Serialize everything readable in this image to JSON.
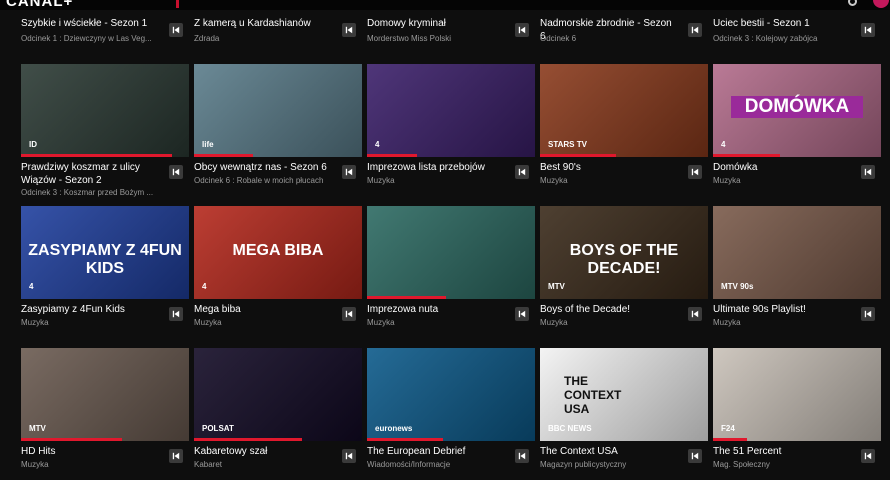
{
  "app": {
    "logo": "CANAL+"
  },
  "row0": [
    {
      "title": "Szybkie i wściekłe - Sezon 1",
      "sub": "Odcinek 1 : Dziewczyny w Las Veg..."
    },
    {
      "title": "Z kamerą u Kardashianów",
      "sub": "Zdrada"
    },
    {
      "title": "Domowy kryminał",
      "sub": "Morderstwo Miss Polski"
    },
    {
      "title": "Nadmorskie zbrodnie - Sezon 6",
      "sub": "Odcinek 6"
    },
    {
      "title": "Uciec bestii - Sezon 1",
      "sub": "Odcinek 3 : Kolejowy zabójca"
    }
  ],
  "row1": [
    {
      "title": "Prawdziwy koszmar z ulicy Wiązów - Sezon 2",
      "sub": "Odcinek 3 : Koszmar przed Bożym ...",
      "badge": "ID",
      "bg": "#2b3a34",
      "progress": 0.9
    },
    {
      "title": "Obcy wewnątrz nas - Sezon 6",
      "sub": "Odcinek 6 : Robale w moich płucach",
      "badge": "life",
      "bg": "#5a7c8a",
      "progress": 0.35
    },
    {
      "title": "Imprezowa lista przebojów",
      "sub": "Muzyka",
      "badge": "4",
      "bg": "#3b1f6a",
      "progress": 0.3
    },
    {
      "title": "Best 90's",
      "sub": "Muzyka",
      "badge": "STARS TV",
      "bg": "#8a3a1c",
      "progress": 0.45
    },
    {
      "title": "Domówka",
      "sub": "Muzyka",
      "badge": "4",
      "bg": "#b26b8a",
      "progress": 0.4,
      "overlay": "DOMÓWKA"
    }
  ],
  "row2": [
    {
      "title": "Zasypiamy z 4Fun Kids",
      "sub": "Muzyka",
      "badge": "4",
      "bg": "#1f3f9e",
      "progress": 0.0,
      "overlay": "ZASYPIAMY Z 4FUN KIDS"
    },
    {
      "title": "Mega biba",
      "sub": "Muzyka",
      "badge": "4",
      "bg": "#b5281c",
      "progress": 0.0,
      "overlay": "MEGA BIBA"
    },
    {
      "title": "Imprezowa nuta",
      "sub": "Muzyka",
      "badge": "",
      "bg": "#2c6a62",
      "progress": 0.47
    },
    {
      "title": "Boys of the Decade!",
      "sub": "Muzyka",
      "badge": "MTV",
      "bg": "#3a2a1a",
      "progress": 0.0,
      "overlay": "BOYS OF THE DECADE!"
    },
    {
      "title": "Ultimate 90s Playlist!",
      "sub": "Muzyka",
      "badge": "MTV 90s",
      "bg": "#7a5a4a",
      "progress": 0.0
    }
  ],
  "row3": [
    {
      "title": "HD Hits",
      "sub": "Muzyka",
      "badge": "MTV",
      "bg": "#6a5a50",
      "progress": 0.6
    },
    {
      "title": "Kabaretowy szał",
      "sub": "Kabaret",
      "badge": "POLSAT",
      "bg": "#120a25",
      "progress": 0.64
    },
    {
      "title": "The European Debrief",
      "sub": "Wiadomości/Informacje",
      "badge": "euronews",
      "bg": "#0c5a8a",
      "progress": 0.45
    },
    {
      "title": "The Context USA",
      "sub": "Magazyn publicystyczny",
      "badge": "BBC NEWS",
      "bg": "#f2f2f2",
      "progress": 0.0,
      "overlay": "THE CONTEXT USA"
    },
    {
      "title": "The 51 Percent",
      "sub": "Mag. Społeczny",
      "badge": "F24",
      "bg": "#c9c1b8",
      "progress": 0.2
    }
  ]
}
